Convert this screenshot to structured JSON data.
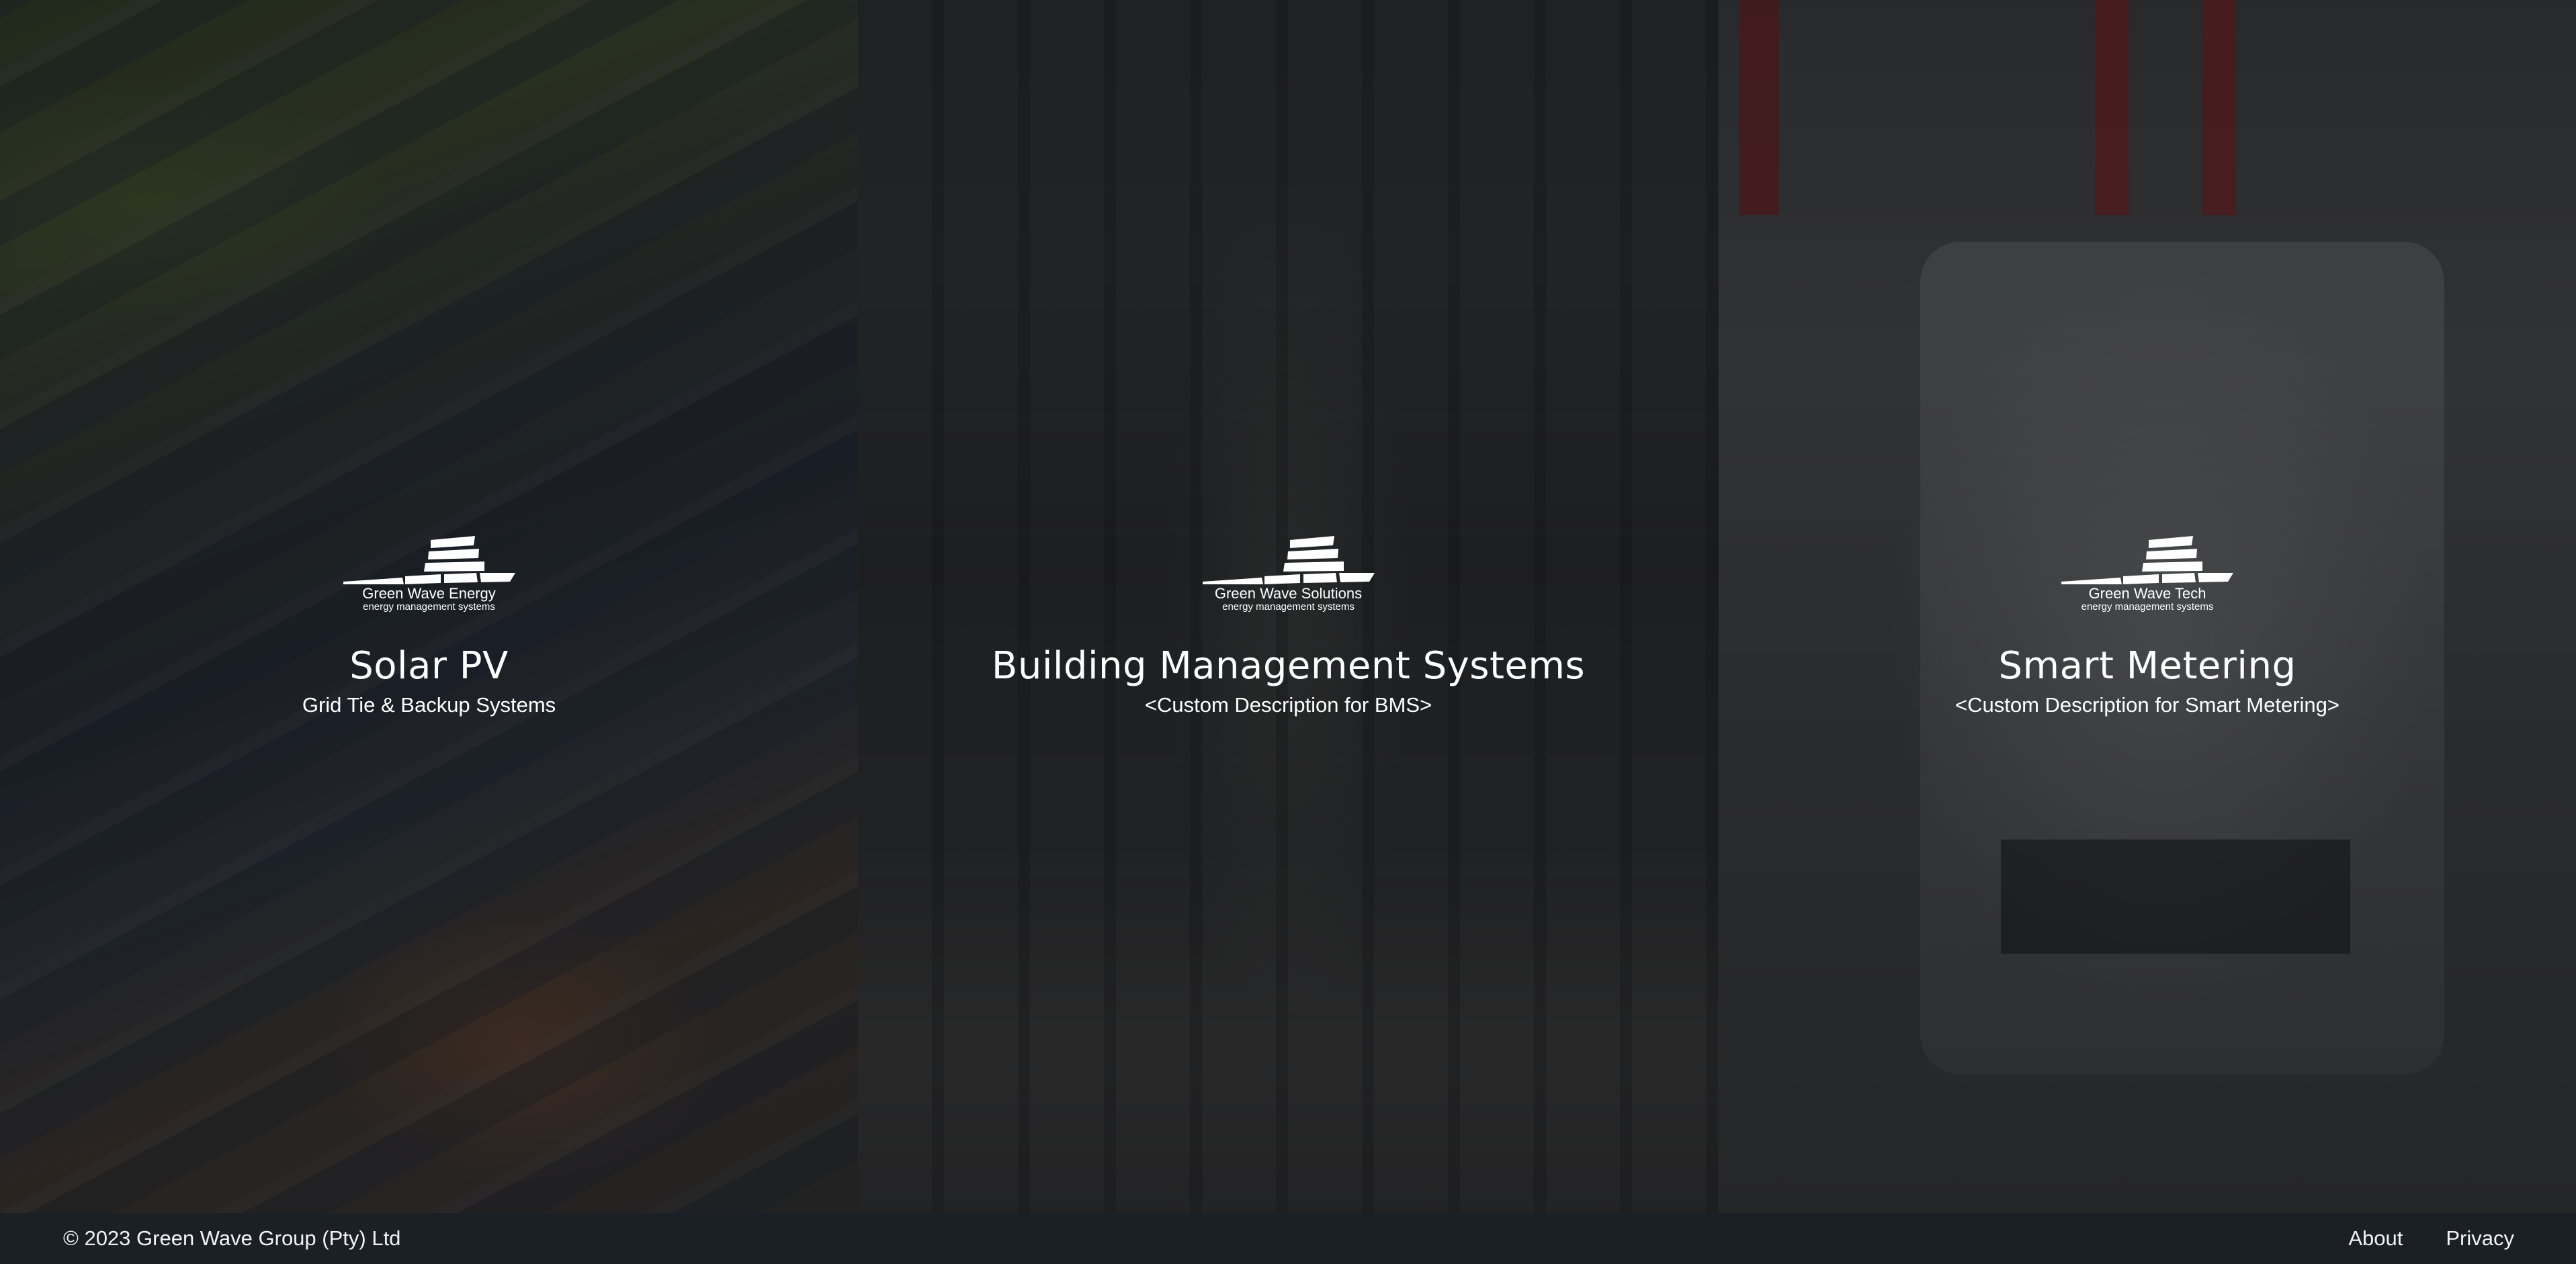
{
  "panels": [
    {
      "logo_name": "Green Wave Energy",
      "logo_tagline": "energy management systems",
      "title": "Solar PV",
      "description": "Grid Tie & Backup Systems"
    },
    {
      "logo_name": "Green Wave Solutions",
      "logo_tagline": "energy management systems",
      "title": "Building Management Systems",
      "description": "<Custom Description for BMS>"
    },
    {
      "logo_name": "Green Wave Tech",
      "logo_tagline": "energy management systems",
      "title": "Smart Metering",
      "description": "<Custom Description for Smart Metering>"
    }
  ],
  "footer": {
    "copyright": "© 2023 Green Wave Group (Pty) Ltd",
    "links": [
      "About",
      "Privacy"
    ]
  },
  "colors": {
    "footer_bg": "#1b2026",
    "text": "#ffffff"
  }
}
